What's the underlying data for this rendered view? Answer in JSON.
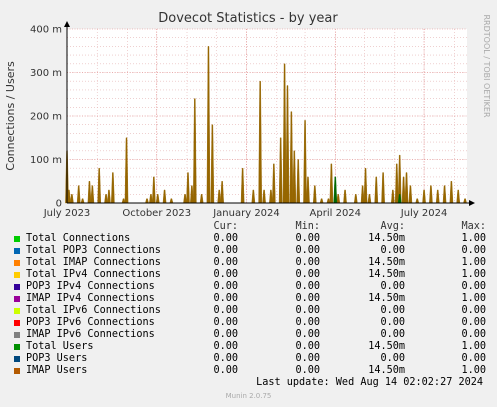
{
  "chart_data": {
    "type": "area",
    "title": "Dovecot Statistics - by year",
    "ylabel": "Connections / Users",
    "xlabel": "",
    "ylim": [
      0,
      0.4
    ],
    "y_ticks": [
      {
        "value": 0,
        "label": "0"
      },
      {
        "value": 0.1,
        "label": "100 m"
      },
      {
        "value": 0.2,
        "label": "200 m"
      },
      {
        "value": 0.3,
        "label": "300 m"
      },
      {
        "value": 0.4,
        "label": "400 m"
      }
    ],
    "xlim": [
      "2023-07-01",
      "2024-08-14"
    ],
    "x_ticks": [
      {
        "date": "2023-07-01",
        "label": "July 2023"
      },
      {
        "date": "2023-10-01",
        "label": "October 2023"
      },
      {
        "date": "2024-01-01",
        "label": "January 2024"
      },
      {
        "date": "2024-04-01",
        "label": "April 2024"
      },
      {
        "date": "2024-07-01",
        "label": "July 2024"
      }
    ],
    "grid": true,
    "series": [
      {
        "name": "IMAP Users",
        "color": "#966600",
        "points": [
          [
            "2023-07-01",
            0.12
          ],
          [
            "2023-07-03",
            0.03
          ],
          [
            "2023-07-06",
            0.02
          ],
          [
            "2023-07-13",
            0.04
          ],
          [
            "2023-07-17",
            0.01
          ],
          [
            "2023-07-24",
            0.05
          ],
          [
            "2023-07-27",
            0.04
          ],
          [
            "2023-08-03",
            0.08
          ],
          [
            "2023-08-10",
            0.02
          ],
          [
            "2023-08-13",
            0.03
          ],
          [
            "2023-08-17",
            0.07
          ],
          [
            "2023-08-28",
            0.01
          ],
          [
            "2023-08-31",
            0.15
          ],
          [
            "2023-09-21",
            0.01
          ],
          [
            "2023-09-25",
            0.02
          ],
          [
            "2023-09-28",
            0.06
          ],
          [
            "2023-10-02",
            0.02
          ],
          [
            "2023-10-09",
            0.03
          ],
          [
            "2023-10-16",
            0.01
          ],
          [
            "2023-10-30",
            0.02
          ],
          [
            "2023-11-02",
            0.07
          ],
          [
            "2023-11-06",
            0.04
          ],
          [
            "2023-11-09",
            0.24
          ],
          [
            "2023-11-16",
            0.02
          ],
          [
            "2023-11-23",
            0.36
          ],
          [
            "2023-11-27",
            0.18
          ],
          [
            "2023-12-04",
            0.03
          ],
          [
            "2023-12-07",
            0.05
          ],
          [
            "2023-12-28",
            0.08
          ],
          [
            "2024-01-08",
            0.03
          ],
          [
            "2024-01-15",
            0.28
          ],
          [
            "2024-01-19",
            0.03
          ],
          [
            "2024-01-26",
            0.03
          ],
          [
            "2024-01-29",
            0.09
          ],
          [
            "2024-02-05",
            0.15
          ],
          [
            "2024-02-09",
            0.32
          ],
          [
            "2024-02-12",
            0.27
          ],
          [
            "2024-02-16",
            0.21
          ],
          [
            "2024-02-19",
            0.12
          ],
          [
            "2024-02-23",
            0.1
          ],
          [
            "2024-03-01",
            0.19
          ],
          [
            "2024-03-04",
            0.06
          ],
          [
            "2024-03-11",
            0.04
          ],
          [
            "2024-03-18",
            0.01
          ],
          [
            "2024-03-25",
            0.01
          ],
          [
            "2024-03-28",
            0.09
          ],
          [
            "2024-04-04",
            0.02
          ],
          [
            "2024-04-11",
            0.03
          ],
          [
            "2024-04-22",
            0.02
          ],
          [
            "2024-04-29",
            0.04
          ],
          [
            "2024-05-02",
            0.08
          ],
          [
            "2024-05-06",
            0.02
          ],
          [
            "2024-05-13",
            0.06
          ],
          [
            "2024-05-20",
            0.07
          ],
          [
            "2024-05-30",
            0.03
          ],
          [
            "2024-06-03",
            0.09
          ],
          [
            "2024-06-06",
            0.11
          ],
          [
            "2024-06-10",
            0.06
          ],
          [
            "2024-06-13",
            0.07
          ],
          [
            "2024-06-17",
            0.04
          ],
          [
            "2024-06-24",
            0.01
          ],
          [
            "2024-07-01",
            0.03
          ],
          [
            "2024-07-08",
            0.04
          ],
          [
            "2024-07-15",
            0.03
          ],
          [
            "2024-07-22",
            0.04
          ],
          [
            "2024-07-29",
            0.05
          ],
          [
            "2024-08-05",
            0.03
          ],
          [
            "2024-08-12",
            0.01
          ]
        ]
      },
      {
        "name": "Total Users",
        "color": "#006600",
        "points": [
          [
            "2024-04-01",
            0.06
          ],
          [
            "2024-06-06",
            0.02
          ]
        ]
      }
    ],
    "side_label": "RRDTOOL / TOBI OETIKER"
  },
  "legend": {
    "headers": [
      "Cur:",
      "Min:",
      "Avg:",
      "Max:"
    ],
    "rows": [
      {
        "name": "Total Connections",
        "color": "#00cc00",
        "cur": "0.00",
        "min": "0.00",
        "avg": "14.50m",
        "max": "1.00"
      },
      {
        "name": "Total POP3 Connections",
        "color": "#0066b3",
        "cur": "0.00",
        "min": "0.00",
        "avg": "0.00",
        "max": "0.00"
      },
      {
        "name": "Total IMAP Connections",
        "color": "#ff8000",
        "cur": "0.00",
        "min": "0.00",
        "avg": "14.50m",
        "max": "1.00"
      },
      {
        "name": "Total IPv4 Connections",
        "color": "#ffcc00",
        "cur": "0.00",
        "min": "0.00",
        "avg": "14.50m",
        "max": "1.00"
      },
      {
        "name": "POP3 IPv4 Connections",
        "color": "#330099",
        "cur": "0.00",
        "min": "0.00",
        "avg": "0.00",
        "max": "0.00"
      },
      {
        "name": "IMAP IPv4 Connections",
        "color": "#990099",
        "cur": "0.00",
        "min": "0.00",
        "avg": "14.50m",
        "max": "1.00"
      },
      {
        "name": "Total IPv6 Connections",
        "color": "#ccff00",
        "cur": "0.00",
        "min": "0.00",
        "avg": "0.00",
        "max": "0.00"
      },
      {
        "name": "POP3 IPv6 Connections",
        "color": "#ff0000",
        "cur": "0.00",
        "min": "0.00",
        "avg": "0.00",
        "max": "0.00"
      },
      {
        "name": "IMAP IPv6 Connections",
        "color": "#808080",
        "cur": "0.00",
        "min": "0.00",
        "avg": "0.00",
        "max": "0.00"
      },
      {
        "name": "Total Users",
        "color": "#008f00",
        "cur": "0.00",
        "min": "0.00",
        "avg": "14.50m",
        "max": "1.00"
      },
      {
        "name": "POP3 Users",
        "color": "#00487d",
        "cur": "0.00",
        "min": "0.00",
        "avg": "0.00",
        "max": "0.00"
      },
      {
        "name": "IMAP Users",
        "color": "#b35a00",
        "cur": "0.00",
        "min": "0.00",
        "avg": "14.50m",
        "max": "1.00"
      }
    ]
  },
  "footer": {
    "last_update": "Last update:  Wed Aug 14 02:02:27 2024",
    "munin": "Munin 2.0.75"
  }
}
